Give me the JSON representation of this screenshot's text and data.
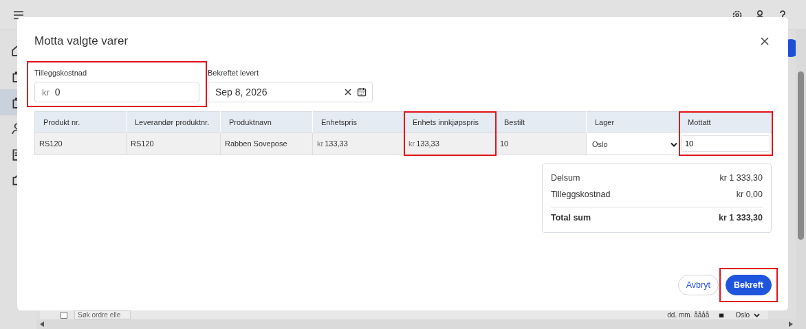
{
  "background": {
    "filter_row": {
      "checked": false,
      "search_placeholder": "Søk ordre elle",
      "date_placeholder": "dd. mm. åååå",
      "warehouse": "Oslo"
    }
  },
  "dialog": {
    "title": "Motta valgte varer",
    "fields": [
      {
        "kind": "money",
        "label": "Tilleggskostnad",
        "prefix": "kr",
        "value": "0",
        "highlighted": true
      },
      {
        "kind": "date",
        "label": "Bekreftet levert",
        "value": "Sep 8, 2026",
        "highlighted": false
      }
    ],
    "table": {
      "columns": [
        {
          "label": "Produkt nr.",
          "highlighted": false
        },
        {
          "label": "Leverandør produktnr.",
          "highlighted": false
        },
        {
          "label": "Produktnavn",
          "highlighted": false
        },
        {
          "label": "Enhetspris",
          "highlighted": false
        },
        {
          "label": "Enhets innkjøpspris",
          "highlighted": true
        },
        {
          "label": "Bestilt",
          "highlighted": false
        },
        {
          "label": "Lager",
          "highlighted": false
        },
        {
          "label": "Mottatt",
          "highlighted": true
        }
      ],
      "rows": [
        {
          "cells": [
            {
              "kind": "text",
              "value": "RS120"
            },
            {
              "kind": "text",
              "value": "RS120"
            },
            {
              "kind": "text",
              "value": "Rabben Sovepose"
            },
            {
              "kind": "money",
              "prefix": "kr",
              "value": "133,33"
            },
            {
              "kind": "money",
              "prefix": "kr",
              "value": "133,33"
            },
            {
              "kind": "text",
              "value": "10"
            },
            {
              "kind": "select",
              "value": "Oslo"
            },
            {
              "kind": "input",
              "value": "10"
            }
          ]
        }
      ]
    },
    "summary": [
      {
        "label": "Delsum",
        "value": "kr 1 333,30",
        "total": false
      },
      {
        "label": "Tilleggskostnad",
        "value": "kr 0,00",
        "total": false
      },
      {
        "label": "Total sum",
        "value": "kr 1 333,30",
        "total": true
      }
    ],
    "buttons": [
      {
        "kind": "secondary",
        "label": "Avbryt",
        "highlighted": false
      },
      {
        "kind": "primary",
        "label": "Bekreft",
        "highlighted": true
      }
    ]
  }
}
